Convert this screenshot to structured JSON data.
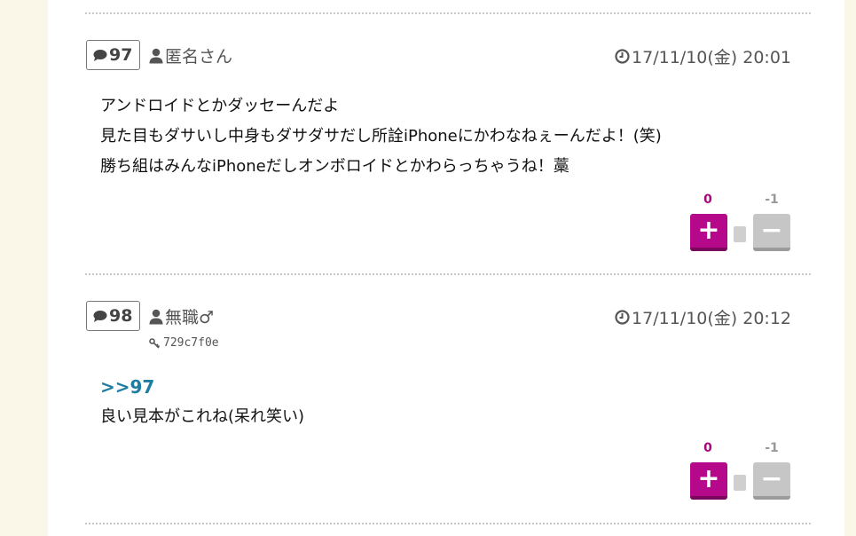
{
  "posts": [
    {
      "number": "97",
      "author": "匿名さん",
      "id": "",
      "date": "17/11/10(金) 20:01",
      "anchor": "",
      "lines": [
        "アンドロイドとかダッセーんだよ",
        "見た目もダサいし中身もダサダサだし所詮iPhoneにかわなねぇーんだよ！(笑)",
        "勝ち組はみんなiPhoneだしオンボロイドとかわらっちゃうね！藁"
      ],
      "plus_count": "0",
      "minus_count": "-1",
      "plus_label": "+",
      "minus_label": "−"
    },
    {
      "number": "98",
      "author": "無職♂",
      "id": "729c7f0e",
      "date": "17/11/10(金) 20:12",
      "anchor": ">>97",
      "lines": [
        "良い見本がこれね(呆れ笑い)"
      ],
      "plus_count": "0",
      "minus_count": "-1",
      "plus_label": "+",
      "minus_label": "−"
    }
  ],
  "icons": {
    "comment": "comment-icon",
    "user": "user-icon",
    "clock": "clock-icon",
    "key": "key-icon"
  },
  "colors": {
    "background": "#faf6e8",
    "plus_button": "#b5088b",
    "minus_button": "#c6c6c6",
    "anchor_link": "#1f7da2"
  }
}
